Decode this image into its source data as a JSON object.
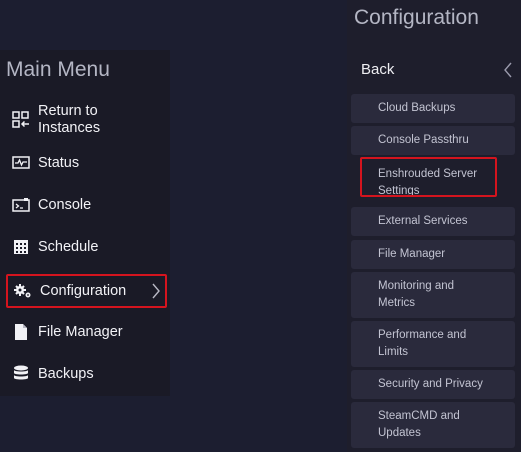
{
  "main_menu": {
    "title": "Main Menu",
    "items": [
      {
        "label": "Return to Instances",
        "icon": "return-instances-icon"
      },
      {
        "label": "Status",
        "icon": "status-monitor-icon"
      },
      {
        "label": "Console",
        "icon": "console-terminal-icon"
      },
      {
        "label": "Schedule",
        "icon": "calendar-icon"
      },
      {
        "label": "Configuration",
        "icon": "gears-icon",
        "selected": true
      },
      {
        "label": "File Manager",
        "icon": "file-icon"
      },
      {
        "label": "Backups",
        "icon": "database-icon"
      }
    ]
  },
  "config_panel": {
    "title": "Configuration",
    "back_label": "Back",
    "items": [
      {
        "label": "Cloud Backups"
      },
      {
        "label": "Console Passthru"
      },
      {
        "label": "Enshrouded Server Settings",
        "highlighted": true
      },
      {
        "label": "External Services"
      },
      {
        "label": "File Manager"
      },
      {
        "label": "Monitoring and Metrics"
      },
      {
        "label": "Performance and Limits"
      },
      {
        "label": "Security and Privacy"
      },
      {
        "label": "SteamCMD and Updates"
      }
    ]
  },
  "colors": {
    "background": "#1c1e30",
    "panel": "#1a1a26",
    "submenu_item": "#2a2a3c",
    "highlight_border": "#d4141e"
  }
}
